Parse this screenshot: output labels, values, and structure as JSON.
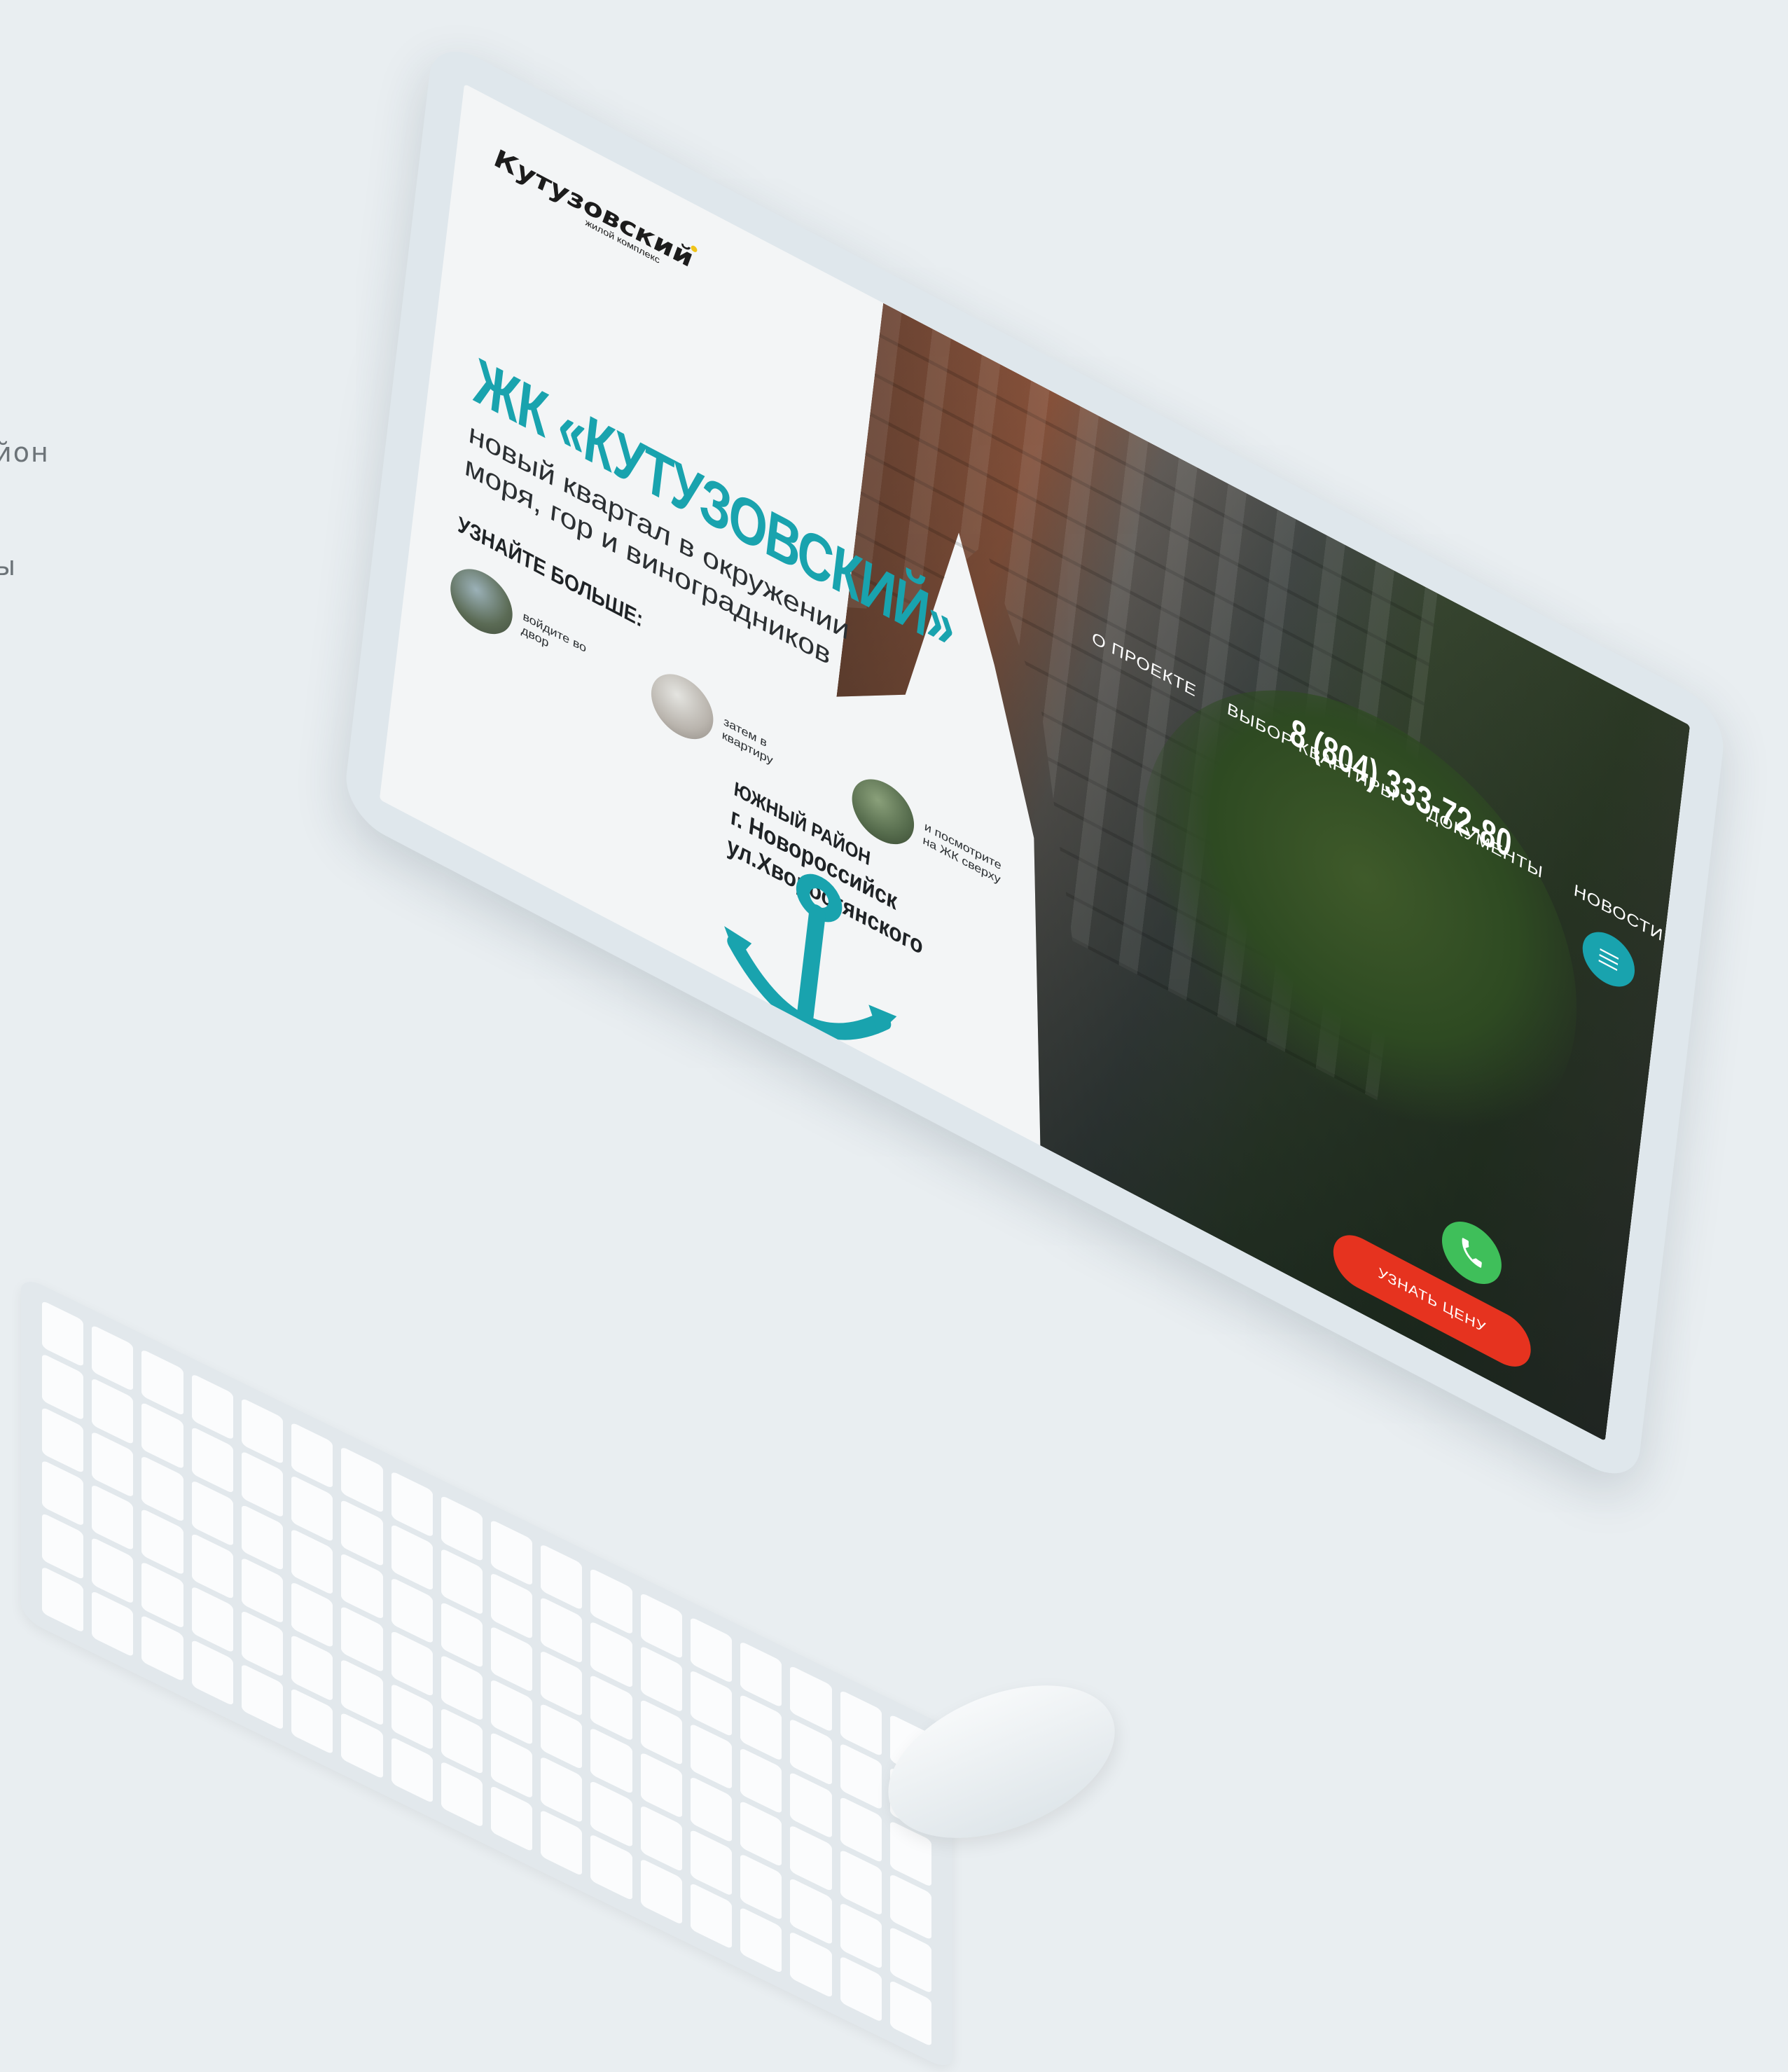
{
  "background_color": "#e9eef1",
  "side_text": [
    "йон",
    "ы"
  ],
  "site": {
    "logo_text": "Кутузовский",
    "logo_subtitle": "жилой комплекс",
    "nav": [
      "О ПРОЕКТЕ",
      "ВЫБОР КВАРТИРЫ",
      "ДОКУМЕНТЫ",
      "НОВОСТИ"
    ],
    "phone": "8 (804) 333-72-80",
    "hero_title": "ЖК «КУТУЗОВСКИЙ»",
    "hero_subtitle": "новый квартал в окружении моря, гор и виноградников",
    "learn_more": "УЗНАЙТЕ БОЛЬШЕ:",
    "tours": [
      {
        "label": "войдите во двор",
        "icon": "courtyard-thumbnail"
      },
      {
        "label": "затем в квартиру",
        "icon": "apartment-thumbnail"
      },
      {
        "label": "и посмотрите на ЖК сверху",
        "icon": "aerial-thumbnail"
      }
    ],
    "address": {
      "district": "ЮЖНЫЙ РАЙОН",
      "city": "г. Новороссийск",
      "street": "ул.Хворостянского"
    },
    "price_button": "УЗНАТЬ ЦЕНУ",
    "colors": {
      "accent": "#19a3ae",
      "call": "#3fbf5a",
      "cta": "#e6331f",
      "logo_dot": "#f0c419"
    },
    "icons": [
      "anchor-icon",
      "menu-icon",
      "phone-icon"
    ]
  }
}
